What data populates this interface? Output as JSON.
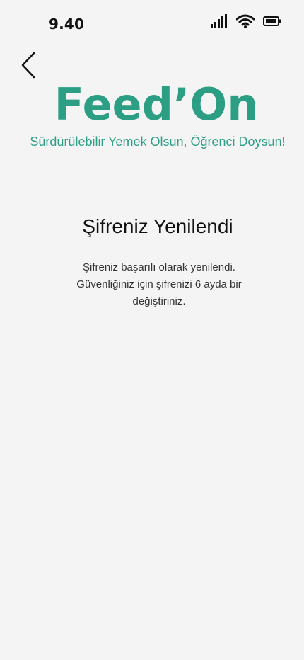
{
  "status_bar": {
    "time": "9.40",
    "icons": [
      "signal-icon",
      "wifi-icon",
      "battery-icon"
    ]
  },
  "navigation": {
    "back_icon": "chevron-left-icon"
  },
  "brand": {
    "title": "Feed’On",
    "tagline": "Sürdürülebilir Yemek Olsun, Öğrenci Doysun!",
    "color": "#2b9e84"
  },
  "content": {
    "title": "Şifreniz Yenilendi",
    "message_line1": "Şifreniz başarılı olarak yenilendi.",
    "message_line2": "Güvenliğiniz için şifrenizi 6 ayda bir",
    "message_line3": "değiştiriniz."
  },
  "colors": {
    "background": "#f4f4f4",
    "accent": "#2b9e84"
  }
}
